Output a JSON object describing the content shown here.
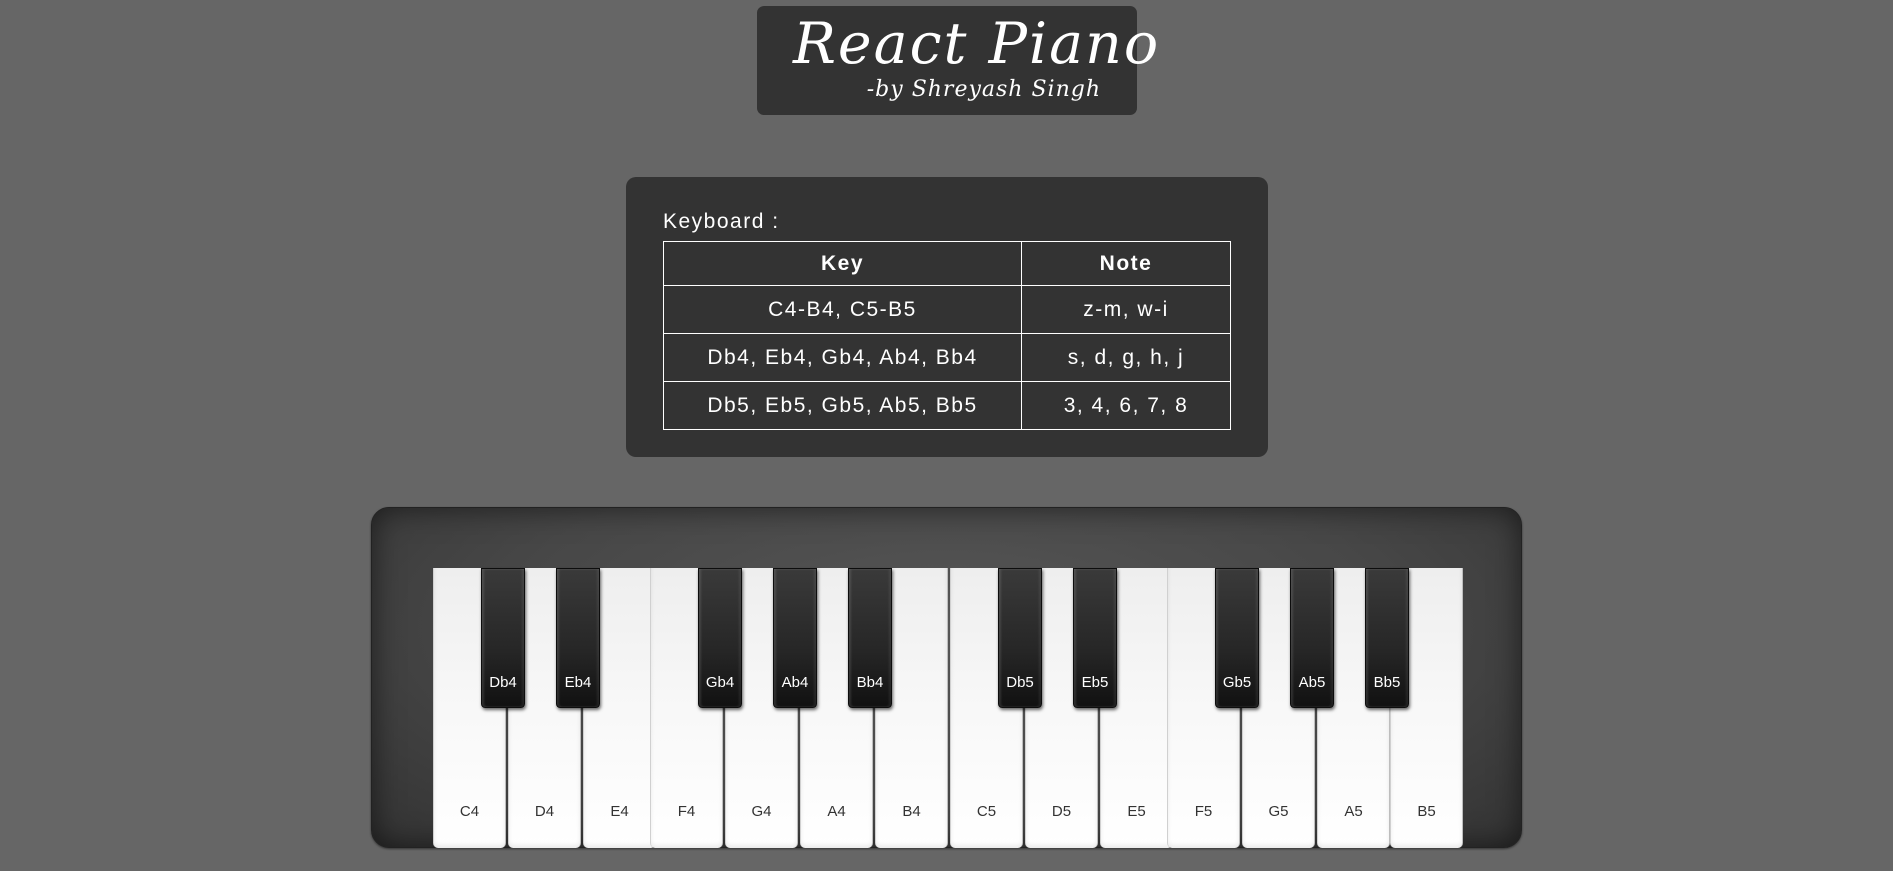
{
  "header": {
    "title": "React Piano",
    "subtitle": "-by Shreyash Singh"
  },
  "keyboard_info": {
    "label": "Keyboard :",
    "columns": [
      "Key",
      "Note"
    ],
    "rows": [
      {
        "key": "C4-B4, C5-B5",
        "note": "z-m, w-i"
      },
      {
        "key": "Db4, Eb4, Gb4, Ab4, Bb4",
        "note": "s, d, g, h, j"
      },
      {
        "key": "Db5, Eb5, Gb5, Ab5, Bb5",
        "note": "3, 4, 6, 7, 8"
      }
    ]
  },
  "piano": {
    "white_keys": [
      "C4",
      "D4",
      "E4",
      "F4",
      "G4",
      "A4",
      "B4",
      "C5",
      "D5",
      "E5",
      "F5",
      "G5",
      "A5",
      "B5"
    ],
    "black_keys": [
      "Db4",
      "Eb4",
      "Gb4",
      "Ab4",
      "Bb4",
      "Db5",
      "Eb5",
      "Gb5",
      "Ab5",
      "Bb5"
    ]
  }
}
